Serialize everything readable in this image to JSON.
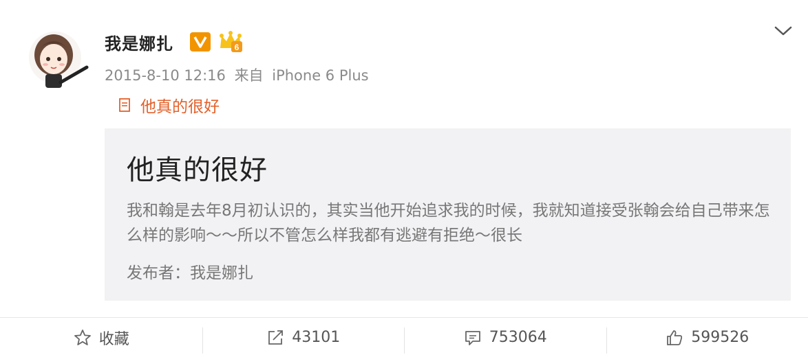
{
  "post": {
    "username": "我是娜扎",
    "verified_badge": "V",
    "member_icon": "crown-member-icon",
    "date": "2015-8-10 12:16",
    "source_prefix": "来自",
    "source": "iPhone 6 Plus",
    "article_link_label": "他真的很好",
    "accent_color": "#e3602a"
  },
  "card": {
    "title": "他真的很好",
    "body": "我和翰是去年8月初认识的，其实当他开始追求我的时候，我就知道接受张翰会给自己带来怎么样的影响～～所以不管怎么样我都有逃避有拒绝～很长",
    "author": "发布者：我是娜扎"
  },
  "actions": {
    "favorite_label": "收藏",
    "repost_count": "43101",
    "comment_count": "753064",
    "like_count": "599526"
  }
}
